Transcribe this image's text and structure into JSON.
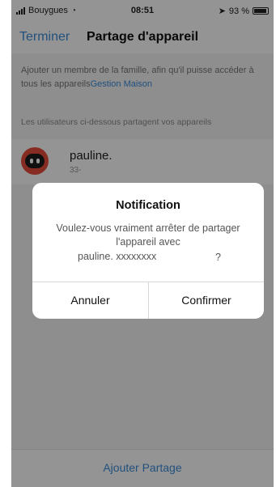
{
  "status_bar": {
    "carrier": "Bouygues",
    "time": "08:51",
    "battery": "93 %",
    "battery_level": 0.93
  },
  "nav": {
    "left_label": "Terminer",
    "title": "Partage d'appareil"
  },
  "info": {
    "text": "Ajouter un membre de la famille, afin qu'il puisse accéder à tous les appareils",
    "link": "Gestion Maison"
  },
  "section_header": "Les utilisateurs ci-dessous partagent vos appareils",
  "user": {
    "name": "pauline.",
    "sub": "33-"
  },
  "bottom_button": "Ajouter Partage",
  "dialog": {
    "title": "Notification",
    "message": "Voulez-vous vraiment arrêter de partager l'appareil avec",
    "user_line": "pauline. xxxxxxxx",
    "question_mark": "?",
    "cancel": "Annuler",
    "confirm": "Confirmer"
  },
  "colors": {
    "accent": "#3a8bd8",
    "avatar": "#e74c3c"
  }
}
